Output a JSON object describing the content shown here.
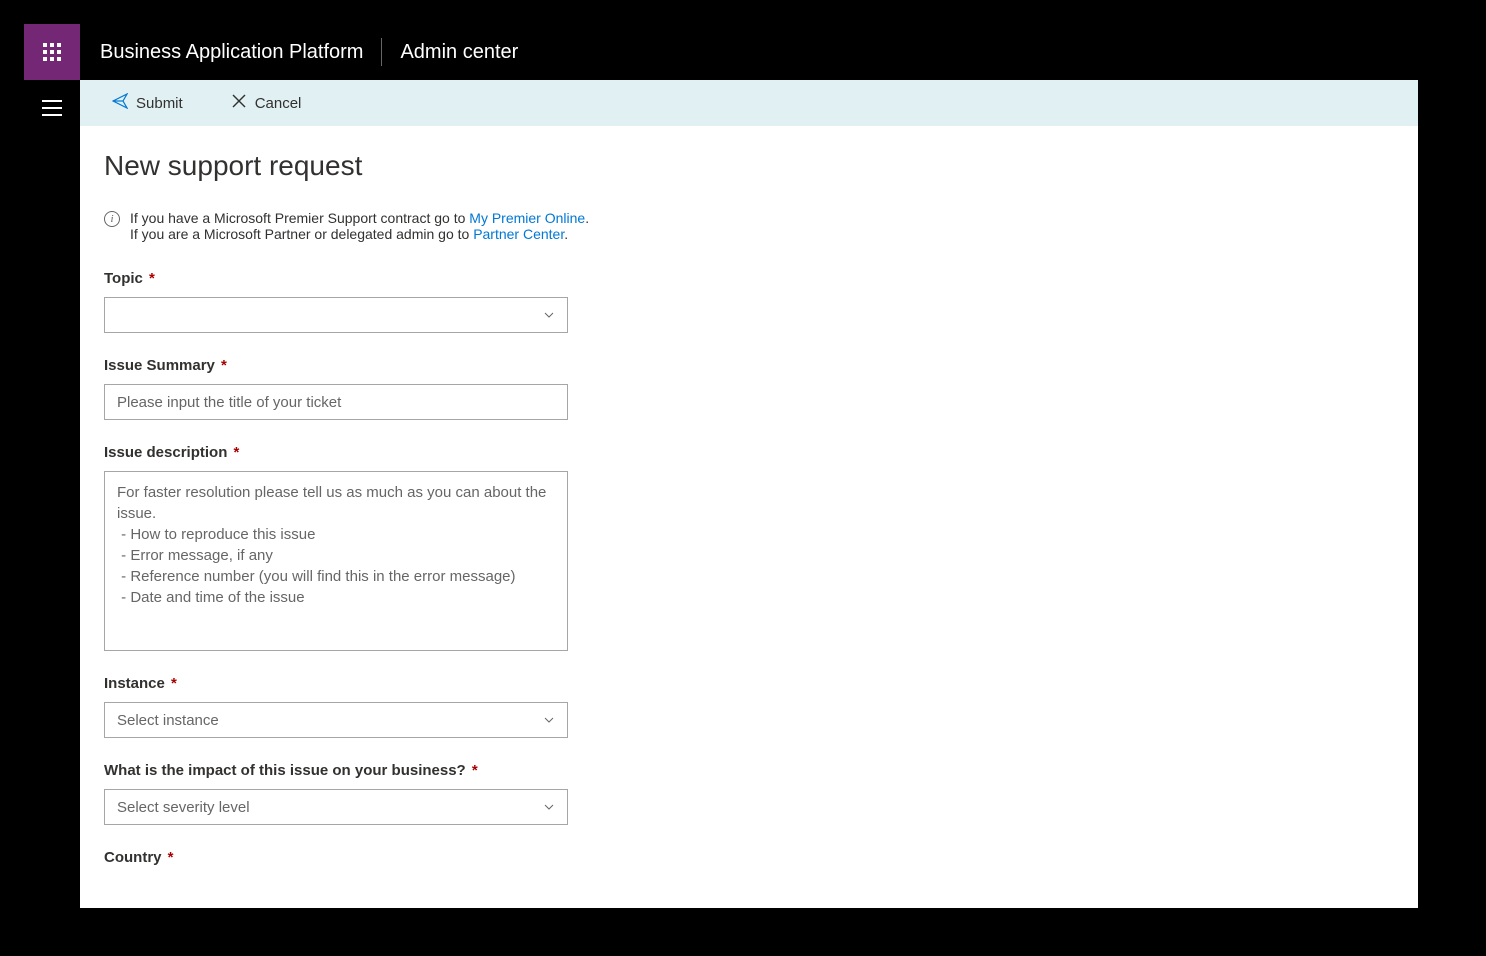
{
  "header": {
    "product": "Business Application Platform",
    "area": "Admin center"
  },
  "cmdbar": {
    "submit": "Submit",
    "cancel": "Cancel"
  },
  "page": {
    "title": "New support request"
  },
  "info": {
    "line1_pre": "If you have a Microsoft Premier Support contract go to ",
    "line1_link": "My Premier Online",
    "line1_post": ".",
    "line2_pre": "If you are a Microsoft Partner or delegated admin go to ",
    "line2_link": "Partner Center",
    "line2_post": "."
  },
  "form": {
    "topic": {
      "label": "Topic"
    },
    "summary": {
      "label": "Issue Summary",
      "placeholder": "Please input the title of your ticket"
    },
    "description": {
      "label": "Issue description",
      "placeholder": "For faster resolution please tell us as much as you can about the issue.\n - How to reproduce this issue\n - Error message, if any\n - Reference number (you will find this in the error message)\n - Date and time of the issue"
    },
    "instance": {
      "label": "Instance",
      "placeholder": "Select instance"
    },
    "impact": {
      "label": "What is the impact of this issue on your business?",
      "placeholder": "Select severity level"
    },
    "country": {
      "label": "Country"
    }
  }
}
